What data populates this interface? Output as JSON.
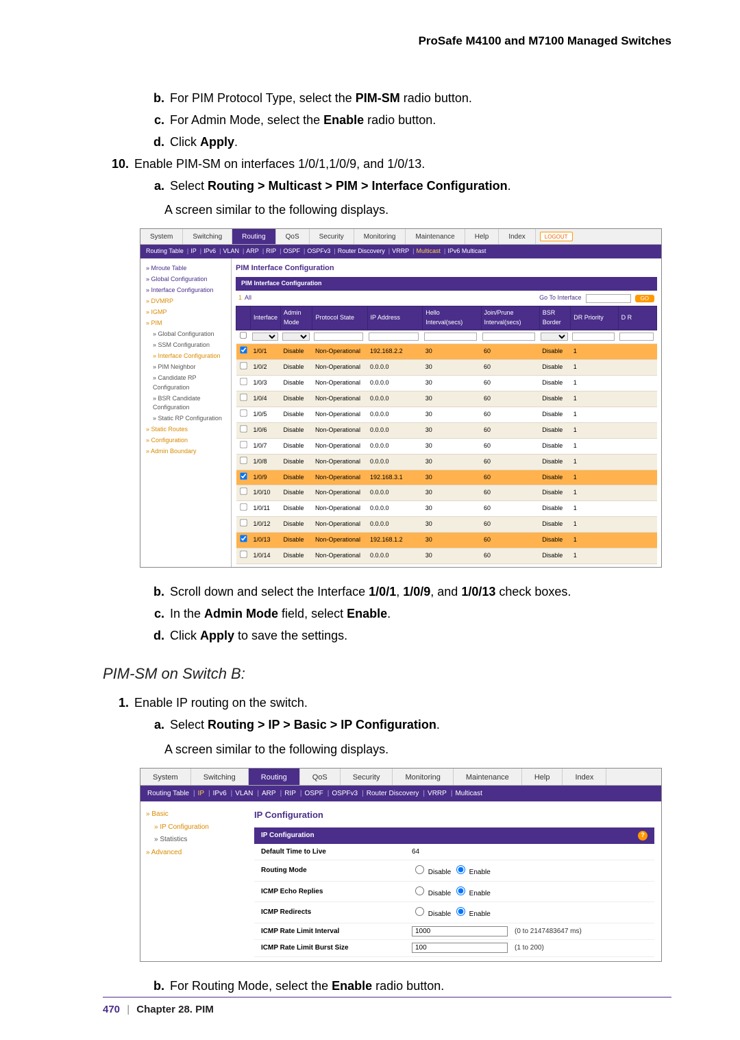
{
  "header": "ProSafe M4100 and M7100 Managed Switches",
  "steps": {
    "s9b_prefix": "b.",
    "s9b": "For PIM Protocol Type, select the ",
    "s9b_bold": "PIM-SM",
    "s9b_suffix": " radio button.",
    "s9c_prefix": "c.",
    "s9c": "For Admin Mode, select the ",
    "s9c_bold": "Enable",
    "s9c_suffix": " radio button.",
    "s9d_prefix": "d.",
    "s9d": "Click ",
    "s9d_bold": "Apply",
    "s9d_suffix": ".",
    "s10_prefix": "10.",
    "s10": "Enable PIM-SM on interfaces 1/0/1,1/0/9, and 1/0/13.",
    "s10a_prefix": "a.",
    "s10a": "Select ",
    "s10a_bold": "Routing > Multicast > PIM > Interface Configuration",
    "s10a_suffix": ".",
    "s10a_after": "A screen similar to the following displays.",
    "s10b_prefix": "b.",
    "s10b": "Scroll down and select the Interface ",
    "s10b_b1": "1/0/1",
    "s10b_mid1": ", ",
    "s10b_b2": "1/0/9",
    "s10b_mid2": ", and ",
    "s10b_b3": "1/0/13",
    "s10b_suffix": " check boxes.",
    "s10c_prefix": "c.",
    "s10c": "In the ",
    "s10c_b1": "Admin Mode",
    "s10c_mid": " field, select ",
    "s10c_b2": "Enable",
    "s10c_suffix": ".",
    "s10d_prefix": "d.",
    "s10d": "Click ",
    "s10d_bold": "Apply",
    "s10d_suffix": " to save the settings."
  },
  "sectionB_title": "PIM-SM on Switch B:",
  "sb": {
    "s1_prefix": "1.",
    "s1": "Enable IP routing on the switch.",
    "s1a_prefix": "a.",
    "s1a": "Select ",
    "s1a_bold": "Routing > IP > Basic > IP Configuration",
    "s1a_suffix": ".",
    "s1a_after": "A screen similar to the following displays.",
    "s1b_prefix": "b.",
    "s1b": "For Routing Mode, select the ",
    "s1b_bold": "Enable",
    "s1b_suffix": " radio button."
  },
  "footer": {
    "page": "470",
    "sep": "|",
    "chapter": "Chapter 28.  PIM"
  },
  "shot1": {
    "tabs": [
      "System",
      "Switching",
      "Routing",
      "QoS",
      "Security",
      "Monitoring",
      "Maintenance",
      "Help",
      "Index"
    ],
    "tabs_active": 2,
    "logout": "LOGOUT",
    "subtabs": [
      "Routing Table",
      "IP",
      "IPv6",
      "VLAN",
      "ARP",
      "RIP",
      "OSPF",
      "OSPFv3",
      "Router Discovery",
      "VRRP",
      "Multicast",
      "IPv6 Multicast"
    ],
    "subtabs_hl": 10,
    "sidenav": [
      {
        "t": "Mroute Table",
        "l": 1
      },
      {
        "t": "Global Configuration",
        "l": 1
      },
      {
        "t": "Interface Configuration",
        "l": 1
      },
      {
        "t": "DVMRP",
        "l": 1,
        "hl": true
      },
      {
        "t": "IGMP",
        "l": 1,
        "hl": true
      },
      {
        "t": "PIM",
        "l": 1,
        "hl": true
      },
      {
        "t": "Global Configuration",
        "l": 2
      },
      {
        "t": "SSM Configuration",
        "l": 2
      },
      {
        "t": "Interface Configuration",
        "l": 2,
        "hl": true
      },
      {
        "t": "PIM Neighbor",
        "l": 2
      },
      {
        "t": "Candidate RP Configuration",
        "l": 2
      },
      {
        "t": "BSR Candidate Configuration",
        "l": 2
      },
      {
        "t": "Static RP Configuration",
        "l": 2
      },
      {
        "t": "Static Routes",
        "l": 1,
        "hl": true
      },
      {
        "t": "Configuration",
        "l": 1,
        "hl": true
      },
      {
        "t": "Admin Boundary",
        "l": 1,
        "hl": true
      }
    ],
    "title": "PIM Interface Configuration",
    "panelTitle": "PIM Interface Configuration",
    "all": "All",
    "goto": "Go To Interface",
    "go": "GO",
    "cols": [
      "",
      "Interface",
      "Admin Mode",
      "Protocol State",
      "IP Address",
      "Hello Interval(secs)",
      "Join/Prune Interval(secs)",
      "BSR Border",
      "DR Priority",
      "D R"
    ],
    "rows": [
      {
        "sel": true,
        "c": [
          "1/0/1",
          "Disable",
          "Non-Operational",
          "192.168.2.2",
          "30",
          "60",
          "Disable",
          "1",
          ""
        ],
        "hl": true
      },
      {
        "sel": false,
        "c": [
          "1/0/2",
          "Disable",
          "Non-Operational",
          "0.0.0.0",
          "30",
          "60",
          "Disable",
          "1",
          ""
        ],
        "alt": true
      },
      {
        "sel": false,
        "c": [
          "1/0/3",
          "Disable",
          "Non-Operational",
          "0.0.0.0",
          "30",
          "60",
          "Disable",
          "1",
          ""
        ]
      },
      {
        "sel": false,
        "c": [
          "1/0/4",
          "Disable",
          "Non-Operational",
          "0.0.0.0",
          "30",
          "60",
          "Disable",
          "1",
          ""
        ],
        "alt": true
      },
      {
        "sel": false,
        "c": [
          "1/0/5",
          "Disable",
          "Non-Operational",
          "0.0.0.0",
          "30",
          "60",
          "Disable",
          "1",
          ""
        ]
      },
      {
        "sel": false,
        "c": [
          "1/0/6",
          "Disable",
          "Non-Operational",
          "0.0.0.0",
          "30",
          "60",
          "Disable",
          "1",
          ""
        ],
        "alt": true
      },
      {
        "sel": false,
        "c": [
          "1/0/7",
          "Disable",
          "Non-Operational",
          "0.0.0.0",
          "30",
          "60",
          "Disable",
          "1",
          ""
        ]
      },
      {
        "sel": false,
        "c": [
          "1/0/8",
          "Disable",
          "Non-Operational",
          "0.0.0.0",
          "30",
          "60",
          "Disable",
          "1",
          ""
        ],
        "alt": true
      },
      {
        "sel": true,
        "c": [
          "1/0/9",
          "Disable",
          "Non-Operational",
          "192.168.3.1",
          "30",
          "60",
          "Disable",
          "1",
          ""
        ],
        "hl": true
      },
      {
        "sel": false,
        "c": [
          "1/0/10",
          "Disable",
          "Non-Operational",
          "0.0.0.0",
          "30",
          "60",
          "Disable",
          "1",
          ""
        ],
        "alt": true
      },
      {
        "sel": false,
        "c": [
          "1/0/11",
          "Disable",
          "Non-Operational",
          "0.0.0.0",
          "30",
          "60",
          "Disable",
          "1",
          ""
        ]
      },
      {
        "sel": false,
        "c": [
          "1/0/12",
          "Disable",
          "Non-Operational",
          "0.0.0.0",
          "30",
          "60",
          "Disable",
          "1",
          ""
        ],
        "alt": true
      },
      {
        "sel": true,
        "c": [
          "1/0/13",
          "Disable",
          "Non-Operational",
          "192.168.1.2",
          "30",
          "60",
          "Disable",
          "1",
          ""
        ],
        "hl": true
      },
      {
        "sel": false,
        "c": [
          "1/0/14",
          "Disable",
          "Non-Operational",
          "0.0.0.0",
          "30",
          "60",
          "Disable",
          "1",
          ""
        ],
        "alt": true
      }
    ]
  },
  "shot2": {
    "tabs": [
      "System",
      "Switching",
      "Routing",
      "QoS",
      "Security",
      "Monitoring",
      "Maintenance",
      "Help",
      "Index"
    ],
    "tabs_active": 2,
    "subtabs": [
      "Routing Table",
      "IP",
      "IPv6",
      "VLAN",
      "ARP",
      "RIP",
      "OSPF",
      "OSPFv3",
      "Router Discovery",
      "VRRP",
      "Multicast"
    ],
    "subtabs_hl": 1,
    "sidenav": [
      {
        "t": "Basic",
        "l": 1,
        "hl": true
      },
      {
        "t": "IP Configuration",
        "l": 2,
        "hl": true
      },
      {
        "t": "Statistics",
        "l": 2
      },
      {
        "t": "Advanced",
        "l": 1,
        "hl": true
      }
    ],
    "title": "IP Configuration",
    "panelTitle": "IP Configuration",
    "rows": [
      {
        "k": "Default Time to Live",
        "v": "64",
        "type": "text"
      },
      {
        "k": "Routing Mode",
        "type": "radio",
        "opt": [
          "Disable",
          "Enable"
        ],
        "sel": 1
      },
      {
        "k": "ICMP Echo Replies",
        "type": "radio",
        "opt": [
          "Disable",
          "Enable"
        ],
        "sel": 1
      },
      {
        "k": "ICMP Redirects",
        "type": "radio",
        "opt": [
          "Disable",
          "Enable"
        ],
        "sel": 1
      },
      {
        "k": "ICMP Rate Limit Interval",
        "type": "input",
        "v": "1000",
        "hint": "(0 to 2147483647 ms)"
      },
      {
        "k": "ICMP Rate Limit Burst Size",
        "type": "input",
        "v": "100",
        "hint": "(1 to 200)"
      }
    ]
  }
}
